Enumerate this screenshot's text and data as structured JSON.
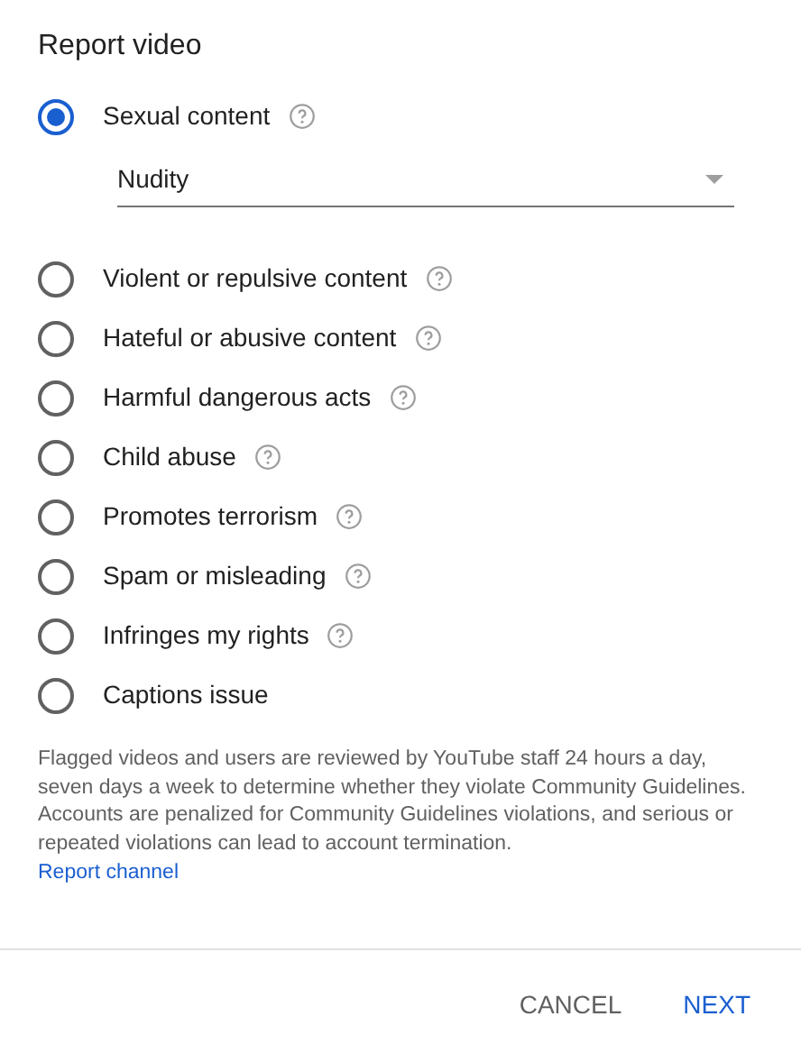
{
  "title": "Report video",
  "options": [
    {
      "label": "Sexual content",
      "selected": true,
      "help": true,
      "dropdown": {
        "value": "Nudity"
      }
    },
    {
      "label": "Violent or repulsive content",
      "selected": false,
      "help": true
    },
    {
      "label": "Hateful or abusive content",
      "selected": false,
      "help": true
    },
    {
      "label": "Harmful dangerous acts",
      "selected": false,
      "help": true
    },
    {
      "label": "Child abuse",
      "selected": false,
      "help": true
    },
    {
      "label": "Promotes terrorism",
      "selected": false,
      "help": true
    },
    {
      "label": "Spam or misleading",
      "selected": false,
      "help": true
    },
    {
      "label": "Infringes my rights",
      "selected": false,
      "help": true
    },
    {
      "label": "Captions issue",
      "selected": false,
      "help": false
    }
  ],
  "notice": "Flagged videos and users are reviewed by YouTube staff 24 hours a day, seven days a week to determine whether they violate Community Guidelines. Accounts are penalized for Community Guidelines violations, and serious or repeated violations can lead to account termination.",
  "link": "Report channel",
  "buttons": [
    {
      "label": "CANCEL",
      "kind": "secondary"
    },
    {
      "label": "NEXT",
      "kind": "primary"
    }
  ]
}
